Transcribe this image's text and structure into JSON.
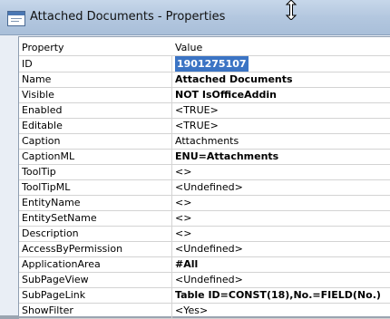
{
  "window": {
    "title": "Attached Documents - Properties"
  },
  "grid": {
    "header": {
      "property": "Property",
      "value": "Value"
    },
    "rows": [
      {
        "property": "ID",
        "value": "1901275107",
        "style": "selected"
      },
      {
        "property": "Name",
        "value": "Attached Documents",
        "style": "bold"
      },
      {
        "property": "Visible",
        "value": "NOT IsOfficeAddin",
        "style": "bold"
      },
      {
        "property": "Enabled",
        "value": "<TRUE>",
        "style": "normal"
      },
      {
        "property": "Editable",
        "value": "<TRUE>",
        "style": "normal"
      },
      {
        "property": "Caption",
        "value": "Attachments",
        "style": "normal"
      },
      {
        "property": "CaptionML",
        "value": "ENU=Attachments",
        "style": "bold"
      },
      {
        "property": "ToolTip",
        "value": "<>",
        "style": "normal"
      },
      {
        "property": "ToolTipML",
        "value": "<Undefined>",
        "style": "normal"
      },
      {
        "property": "EntityName",
        "value": "<>",
        "style": "normal"
      },
      {
        "property": "EntitySetName",
        "value": "<>",
        "style": "normal"
      },
      {
        "property": "Description",
        "value": "<>",
        "style": "normal"
      },
      {
        "property": "AccessByPermission",
        "value": "<Undefined>",
        "style": "normal"
      },
      {
        "property": "ApplicationArea",
        "value": "#All",
        "style": "bold"
      },
      {
        "property": "SubPageView",
        "value": "<Undefined>",
        "style": "normal"
      },
      {
        "property": "SubPageLink",
        "value": "Table ID=CONST(18),No.=FIELD(No.)",
        "style": "bold"
      },
      {
        "property": "ShowFilter",
        "value": "<Yes>",
        "style": "normal"
      }
    ]
  }
}
